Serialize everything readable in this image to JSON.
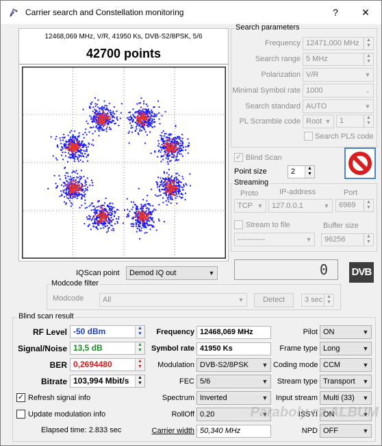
{
  "window": {
    "title": "Carrier search and Constellation monitoring",
    "help_label": "?",
    "close_label": "✕"
  },
  "header": {
    "carrier_info": "12468,069 MHz, V/R, 41950 Ks, DVB-S2/8PSK, 5/6",
    "points": "42700 points"
  },
  "constellation": {
    "dot_color": "#1a1aff",
    "core_color": "#e8322a"
  },
  "search": {
    "group_title": "Search parameters",
    "frequency_label": "Frequency",
    "frequency_value": "12471,000 MHz",
    "range_label": "Search range",
    "range_value": "5 MHz",
    "polarization_label": "Polarization",
    "polarization_value": "V/R",
    "min_sr_label": "Minimal Symbol rate",
    "min_sr_value": "1000",
    "standard_label": "Search standard",
    "standard_value": "AUTO",
    "pls_label": "PL Scramble code",
    "pls_mode": "Root",
    "pls_value": "1",
    "search_pls_label": "Search PLS code"
  },
  "blind": {
    "label": "Blind Scan",
    "point_size_label": "Point size",
    "point_size_value": "2"
  },
  "streaming": {
    "group_title": "Streaming",
    "proto_label": "Proto",
    "ip_label": "IP-address",
    "port_label": "Port",
    "proto_value": "TCP",
    "ip_value": "127.0.0.1",
    "port_value": "6969",
    "stream_file_label": "Stream to file",
    "buffer_label": "Buffer size",
    "file_value": "-----------",
    "buffer_value": "96256"
  },
  "iq": {
    "label": "IQScan point",
    "value": "Demod IQ out",
    "counter": "0"
  },
  "modcode": {
    "group_title": "Modcode filter",
    "label": "Modcode",
    "value": "All",
    "detect_label": "Detect",
    "interval_value": "3 sec"
  },
  "logo": "DVB",
  "result": {
    "group_title": "Blind scan result",
    "rf_label": "RF Level",
    "rf_value": "-50 dBm",
    "snr_label": "Signal/Noise",
    "snr_value": "13,5 dB",
    "ber_label": "BER",
    "ber_value": "0,2694480",
    "bitrate_label": "Bitrate",
    "bitrate_value": "103,994 Mbit/s",
    "freq_label": "Frequency",
    "freq_value": "12468,069 MHz",
    "sr_label": "Symbol rate",
    "sr_value": "41950 Ks",
    "mod_label": "Modulation",
    "mod_value": "DVB-S2/8PSK",
    "fec_label": "FEC",
    "fec_value": "5/6",
    "spectrum_label": "Spectrum",
    "spectrum_value": "Inverted",
    "rolloff_label": "RollOff",
    "rolloff_value": "0.20",
    "cw_label": "Carrier width",
    "cw_value": "50,340 MHz",
    "pilot_label": "Pilot",
    "pilot_value": "ON",
    "frame_label": "Frame type",
    "frame_value": "Long",
    "coding_label": "Coding mode",
    "coding_value": "CCM",
    "stype_label": "Stream type",
    "stype_value": "Transport",
    "input_label": "Input stream",
    "input_value": "Multi (33)",
    "issyi_label": "ISSYI",
    "issyi_value": "ON",
    "npd_label": "NPD",
    "npd_value": "OFF",
    "refresh_label": "Refresh signal info",
    "update_label": "Update modulation info",
    "elapsed": "Elapsed time: 2.833 sec"
  },
  "watermark": "Paraboly.cz ALBUM"
}
